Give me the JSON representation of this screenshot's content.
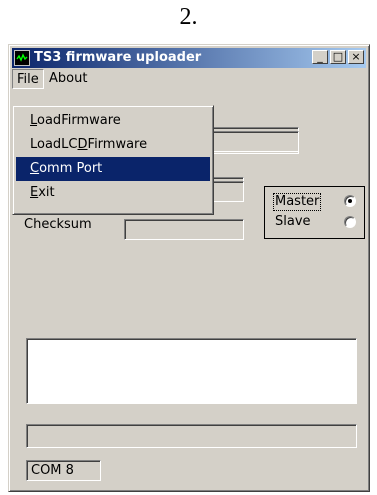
{
  "step_label": "2.",
  "window": {
    "title": "TS3 firmware uploader",
    "buttons": {
      "minimize": "_",
      "maximize": "□",
      "close": "×"
    }
  },
  "menubar": {
    "file": "File",
    "about": "About"
  },
  "file_menu": {
    "items": [
      {
        "label": "LoadFirmware",
        "mnemonic": "L",
        "rest": "oadFirmware"
      },
      {
        "label": "LoadLCDFirmware",
        "pre": "LoadLC",
        "mnemonic": "D",
        "rest": "Firmware"
      },
      {
        "label": "Comm Port",
        "mnemonic": "C",
        "rest": "omm Port",
        "selected": true
      },
      {
        "label": "Exit",
        "mnemonic": "E",
        "rest": "xit"
      }
    ]
  },
  "form": {
    "checksum_label": "Checksum",
    "checksum_value": ""
  },
  "mode": {
    "master_label": "Master",
    "slave_label": "Slave",
    "selected": "Master"
  },
  "log": {
    "text": ""
  },
  "progress": {
    "value": 0
  },
  "status": {
    "port": "COM 8"
  },
  "colors": {
    "title_start": "#0a246a",
    "title_end": "#a6caf0",
    "menu_highlight": "#0a246a",
    "face": "#d4d0c8"
  }
}
